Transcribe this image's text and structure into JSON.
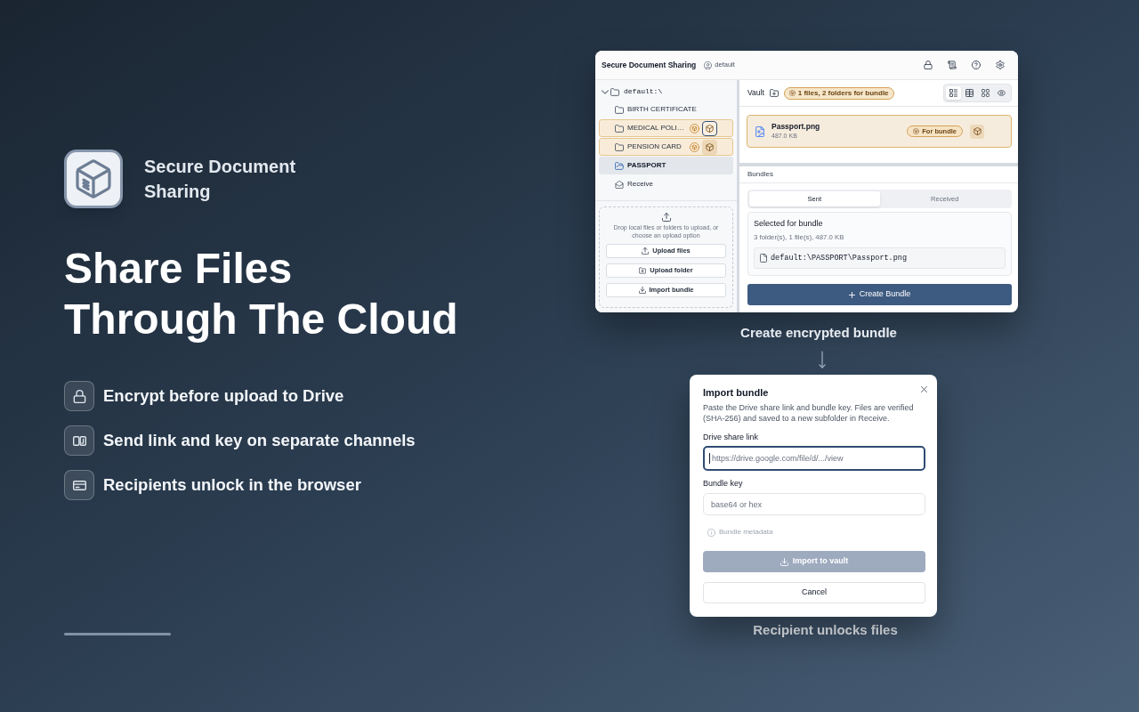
{
  "promo": {
    "app_name": "Secure Document Sharing",
    "headline": "Share Files\nThrough The Cloud",
    "features": [
      "Encrypt before upload to Drive",
      "Send link and key on separate channels",
      "Recipients unlock in the browser"
    ]
  },
  "app_window": {
    "title": "Secure Document Sharing",
    "profile": "default",
    "sidebar": {
      "tree": {
        "label": "default:\\",
        "expanded": true,
        "children": [
          {
            "kind": "folder",
            "label": "BIRTH CERTIFICATE",
            "selected": false,
            "in_bundle": false,
            "focused": false
          },
          {
            "kind": "folder",
            "label": "MEDICAL POLI…",
            "selected": false,
            "in_bundle": true,
            "focused": true
          },
          {
            "kind": "folder",
            "label": "PENSION CARD",
            "selected": false,
            "in_bundle": true,
            "focused": false
          },
          {
            "kind": "folder",
            "label": "PASSPORT",
            "selected": true,
            "in_bundle": false,
            "focused": false
          },
          {
            "kind": "inbox",
            "label": "Receive",
            "selected": false,
            "in_bundle": false,
            "focused": false
          }
        ]
      },
      "drop_zone": {
        "hint": "Drop local files or folders to upload, or choose an upload option",
        "buttons": [
          "Upload files",
          "Upload folder",
          "Import bundle"
        ]
      }
    },
    "vault": {
      "title": "Vault",
      "bundle_badge": "1 files, 2 folders for bundle",
      "view_modes": [
        {
          "selected": true
        },
        {
          "selected": false
        },
        {
          "selected": false
        },
        {
          "selected": false
        }
      ],
      "files": [
        {
          "name": "Passport.png",
          "size": "487.0 KB",
          "in_bundle": true,
          "badge": "For bundle"
        }
      ]
    },
    "bundles": {
      "title": "Bundles",
      "tabs": [
        {
          "label": "Sent",
          "selected": true
        },
        {
          "label": "Received",
          "selected": false
        }
      ],
      "selection": {
        "title": "Selected for bundle",
        "summary": "3 folder(s), 1 file(s), 487.0 KB",
        "paths": [
          "default:\\PASSPORT\\Passport.png"
        ]
      },
      "create_button": "Create Bundle"
    }
  },
  "caption_top": "Create encrypted bundle",
  "dialog": {
    "title": "Import bundle",
    "description": "Paste the Drive share link and bundle key. Files are verified (SHA-256) and saved to a new subfolder in Receive.",
    "fields": [
      {
        "label": "Drive share link",
        "placeholder": "https://drive.google.com/file/d/.../view",
        "focused": true
      },
      {
        "label": "Bundle key",
        "placeholder": "base64 or hex",
        "focused": false
      }
    ],
    "metadata": {
      "label": "Bundle metadata",
      "disabled": true
    },
    "import_button": {
      "label": "Import to vault",
      "disabled": true
    },
    "cancel_button": "Cancel"
  },
  "caption_bottom": "Recipient unlocks files"
}
